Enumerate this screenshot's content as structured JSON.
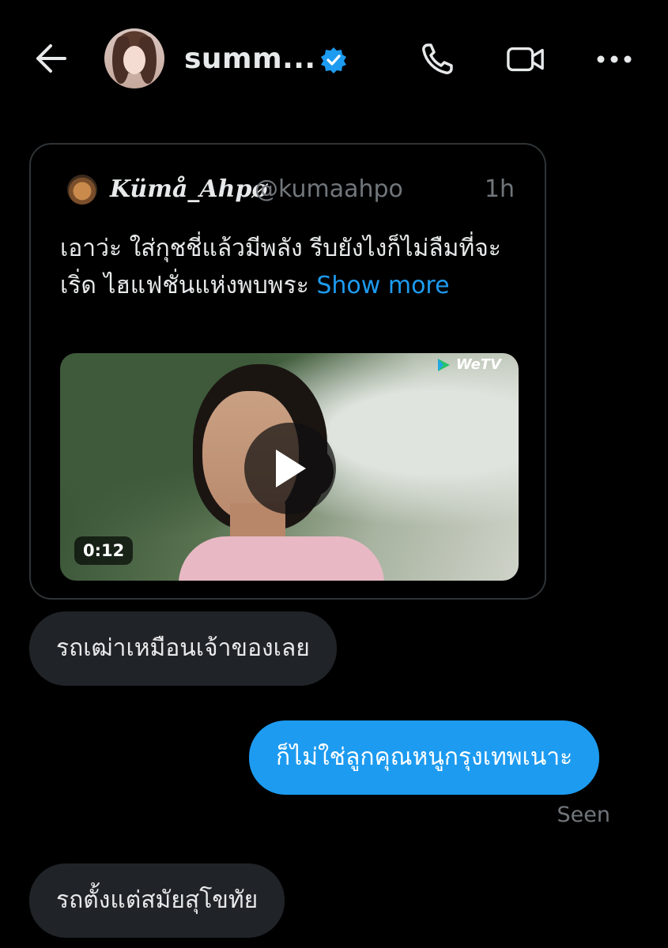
{
  "header": {
    "username": "summ...",
    "icons": {
      "back": "arrow-left-icon",
      "verified": "verified-badge-icon",
      "call": "phone-icon",
      "video": "video-camera-icon",
      "more": "more-horizontal-icon"
    }
  },
  "tweet": {
    "display_name": "Kümå_Ahpø",
    "handle": "@kumaahpo",
    "time": "1h",
    "text": "เอาว่ะ ใส่กุชชี่แล้วมีพลัง รีบยังไงก็ไม่ลืมที่จะเริ่ด  ไฮแฟชั่นแห่งพบพระ ",
    "show_more": "Show more",
    "media": {
      "watermark": "WeTV",
      "duration": "0:12"
    }
  },
  "messages": [
    {
      "direction": "incoming",
      "text": "รถเฒ่าเหมือนเจ้าของเลย"
    },
    {
      "direction": "outgoing",
      "text": "ก็ไม่ใช่ลูกคุณหนูกรุงเทพเนาะ"
    },
    {
      "direction": "incoming",
      "text": "รถตั้งแต่สมัยสุโขทัย"
    }
  ],
  "status": {
    "seen": "Seen"
  },
  "colors": {
    "background": "#000000",
    "accent": "#1d9bf0",
    "incoming_bubble": "#202327",
    "muted": "#71767b"
  }
}
